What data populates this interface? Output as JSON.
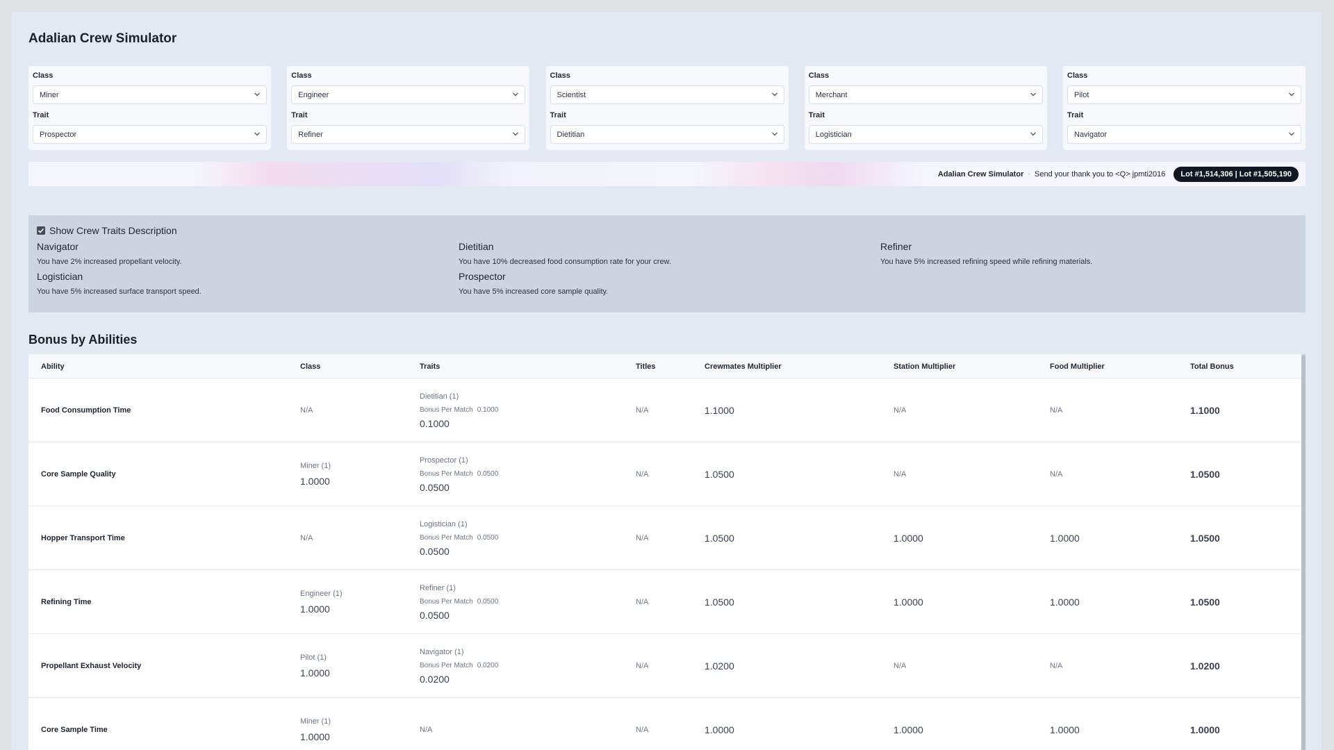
{
  "app": {
    "title": "Adalian Crew Simulator"
  },
  "crew": [
    {
      "class_label": "Class",
      "class_value": "Miner",
      "trait_label": "Trait",
      "trait_value": "Prospector"
    },
    {
      "class_label": "Class",
      "class_value": "Engineer",
      "trait_label": "Trait",
      "trait_value": "Refiner"
    },
    {
      "class_label": "Class",
      "class_value": "Scientist",
      "trait_label": "Trait",
      "trait_value": "Dietitian"
    },
    {
      "class_label": "Class",
      "class_value": "Merchant",
      "trait_label": "Trait",
      "trait_value": "Logistician"
    },
    {
      "class_label": "Class",
      "class_value": "Pilot",
      "trait_label": "Trait",
      "trait_value": "Navigator"
    }
  ],
  "banner": {
    "name": "Adalian Crew Simulator",
    "separator": "·",
    "thanks": "Send your thank you to <Q> jpmti2016",
    "lots": "Lot #1,514,306 | Lot #1,505,190"
  },
  "traits_panel": {
    "checkbox_label": "Show Crew Traits Description",
    "checked": true,
    "items": [
      {
        "name": "Navigator",
        "desc": "You have 2% increased propellant velocity."
      },
      {
        "name": "Dietitian",
        "desc": "You have 10% decreased food consumption rate for your crew."
      },
      {
        "name": "Refiner",
        "desc": "You have 5% increased refining speed while refining materials."
      },
      {
        "name": "Logistician",
        "desc": "You have 5% increased surface transport speed."
      },
      {
        "name": "Prospector",
        "desc": "You have 5% increased core sample quality."
      }
    ]
  },
  "bonus": {
    "title": "Bonus by Abilities",
    "columns": [
      "Ability",
      "Class",
      "Traits",
      "Titles",
      "Crewmates Multiplier",
      "Station Multiplier",
      "Food Multiplier",
      "Total Bonus"
    ],
    "bpm_label": "Bonus Per Match",
    "rows": [
      {
        "ability": "Food Consumption Time",
        "class_name": "",
        "class_value": "N/A",
        "trait_name": "Dietitian (1)",
        "trait_bpm": "0.1000",
        "trait_value": "0.1000",
        "titles": "N/A",
        "crewmates": "1.1000",
        "station": "N/A",
        "food": "N/A",
        "total": "1.1000"
      },
      {
        "ability": "Core Sample Quality",
        "class_name": "Miner (1)",
        "class_value": "1.0000",
        "trait_name": "Prospector (1)",
        "trait_bpm": "0.0500",
        "trait_value": "0.0500",
        "titles": "N/A",
        "crewmates": "1.0500",
        "station": "N/A",
        "food": "N/A",
        "total": "1.0500"
      },
      {
        "ability": "Hopper Transport Time",
        "class_name": "",
        "class_value": "N/A",
        "trait_name": "Logistician (1)",
        "trait_bpm": "0.0500",
        "trait_value": "0.0500",
        "titles": "N/A",
        "crewmates": "1.0500",
        "station": "1.0000",
        "food": "1.0000",
        "total": "1.0500"
      },
      {
        "ability": "Refining Time",
        "class_name": "Engineer (1)",
        "class_value": "1.0000",
        "trait_name": "Refiner (1)",
        "trait_bpm": "0.0500",
        "trait_value": "0.0500",
        "titles": "N/A",
        "crewmates": "1.0500",
        "station": "1.0000",
        "food": "1.0000",
        "total": "1.0500"
      },
      {
        "ability": "Propellant Exhaust Velocity",
        "class_name": "Pilot (1)",
        "class_value": "1.0000",
        "trait_name": "Navigator (1)",
        "trait_bpm": "0.0200",
        "trait_value": "0.0200",
        "titles": "N/A",
        "crewmates": "1.0200",
        "station": "N/A",
        "food": "N/A",
        "total": "1.0200"
      },
      {
        "ability": "Core Sample Time",
        "class_name": "Miner (1)",
        "class_value": "1.0000",
        "trait_name": "",
        "trait_bpm": "",
        "trait_value": "N/A",
        "titles": "N/A",
        "crewmates": "1.0000",
        "station": "1.0000",
        "food": "1.0000",
        "total": "1.0000"
      }
    ]
  },
  "icons": {
    "select": "chevron-down-icon",
    "checkbox": "check-icon"
  }
}
